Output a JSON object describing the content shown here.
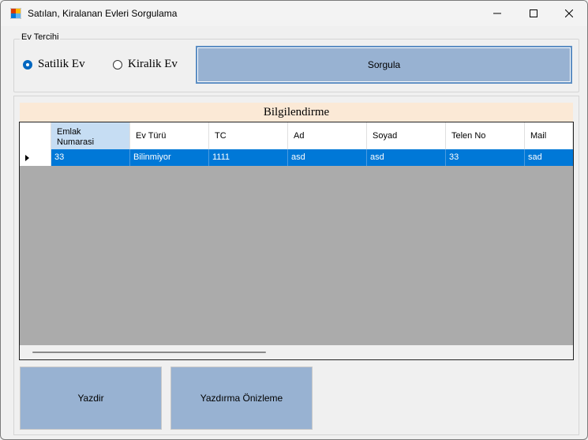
{
  "window": {
    "title": "Satılan, Kiralanan Evleri Sorgulama",
    "icons": {
      "app": "app-icon",
      "minimize": "minimize-icon",
      "maximize": "maximize-icon",
      "close": "close-icon"
    }
  },
  "ev_tercihi": {
    "legend": "Ev Tercihi",
    "options": [
      {
        "label": "Satilik Ev",
        "checked": true
      },
      {
        "label": "Kiralik Ev",
        "checked": false
      }
    ],
    "query_button": "Sorgula"
  },
  "info": {
    "header": "Bilgilendirme",
    "columns": [
      "Emlak\nNumarasi",
      "Ev Türü",
      "TC",
      "Ad",
      "Soyad",
      "Telen No",
      "Mail"
    ],
    "rows": [
      [
        "33",
        "Bilinmiyor",
        "1111",
        "asd",
        "asd",
        "33",
        "sad"
      ]
    ]
  },
  "actions": {
    "print": "Yazdir",
    "print_preview": "Yazdırma Önizleme"
  },
  "colors": {
    "button_bg": "#98b2d2",
    "selection": "#0078d7",
    "header_highlight": "#c6ddf3",
    "info_bg": "#fbe9d6",
    "grid_bg": "#ababab"
  }
}
